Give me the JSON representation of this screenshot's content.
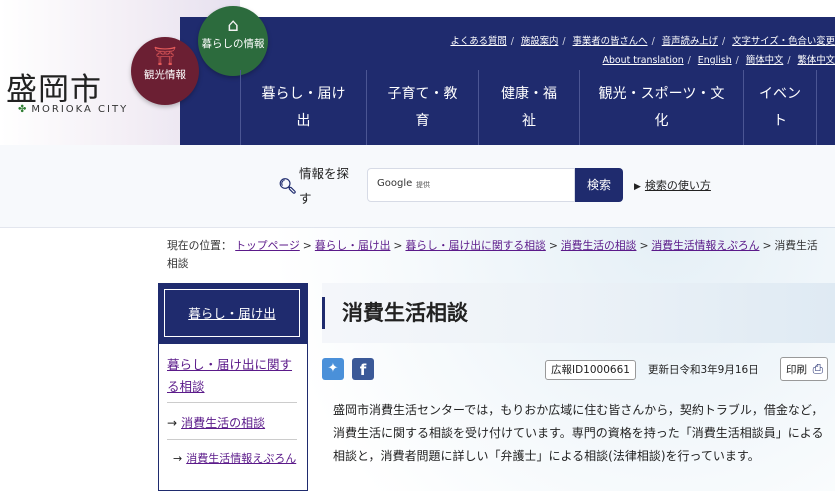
{
  "header": {
    "logo_jp": "盛岡市",
    "logo_en": "MORIOKA CITY",
    "circle_kanko": "観光情報",
    "circle_kurashi": "暮らしの情報",
    "toplinks": [
      "よくある質問",
      "施設案内",
      "事業者の皆さんへ",
      "音声読み上げ",
      "文字サイズ・色合い変更"
    ],
    "toplinks2": [
      "About translation",
      "English",
      "簡体中文",
      "繁体中文"
    ],
    "menu": [
      "暮らし・届け出",
      "子育て・教育",
      "健康・福祉",
      "観光・スポーツ・文化",
      "イベント"
    ]
  },
  "search": {
    "label": "情報を探す",
    "google_label": "Google",
    "google_sub": "提供",
    "button": "検索",
    "howto": "検索の使い方"
  },
  "breadcrumb": {
    "prefix": "現在の位置：",
    "items": [
      "トップページ",
      "暮らし・届け出",
      "暮らし・届け出に関する相談",
      "消費生活の相談",
      "消費生活情報えぷろん"
    ],
    "current": "消費生活相談"
  },
  "sidenav": {
    "heading": "暮らし・届け出",
    "level1": "暮らし・届け出に関する相談",
    "level2": "消費生活の相談",
    "level3": "消費生活情報えぷろん"
  },
  "main": {
    "title": "消費生活相談",
    "pr_id": "広報ID1000661",
    "updated": "更新日令和3年9月16日",
    "print": "印刷",
    "body": "盛岡市消費生活センターでは，もりおか広域に住む皆さんから，契約トラブル，借金など，消費生活に関する相談を受け付けています。専門の資格を持った「消費生活相談員」による相談と，消費者問題に詳しい「弁護士」による相談(法律相談)を行っています。"
  },
  "colors": {
    "navy": "#1f2b6e",
    "link_purple": "#5b1a8a",
    "kanko_circle": "#6b1f33",
    "kurashi_circle": "#2c6b3d",
    "twitter": "#4a90d9",
    "facebook": "#3b5998"
  },
  "icons": {
    "search": "search-icon",
    "twitter": "twitter-icon",
    "facebook": "facebook-icon",
    "print": "printer-icon",
    "torii": "torii-icon",
    "house": "house-icon"
  }
}
